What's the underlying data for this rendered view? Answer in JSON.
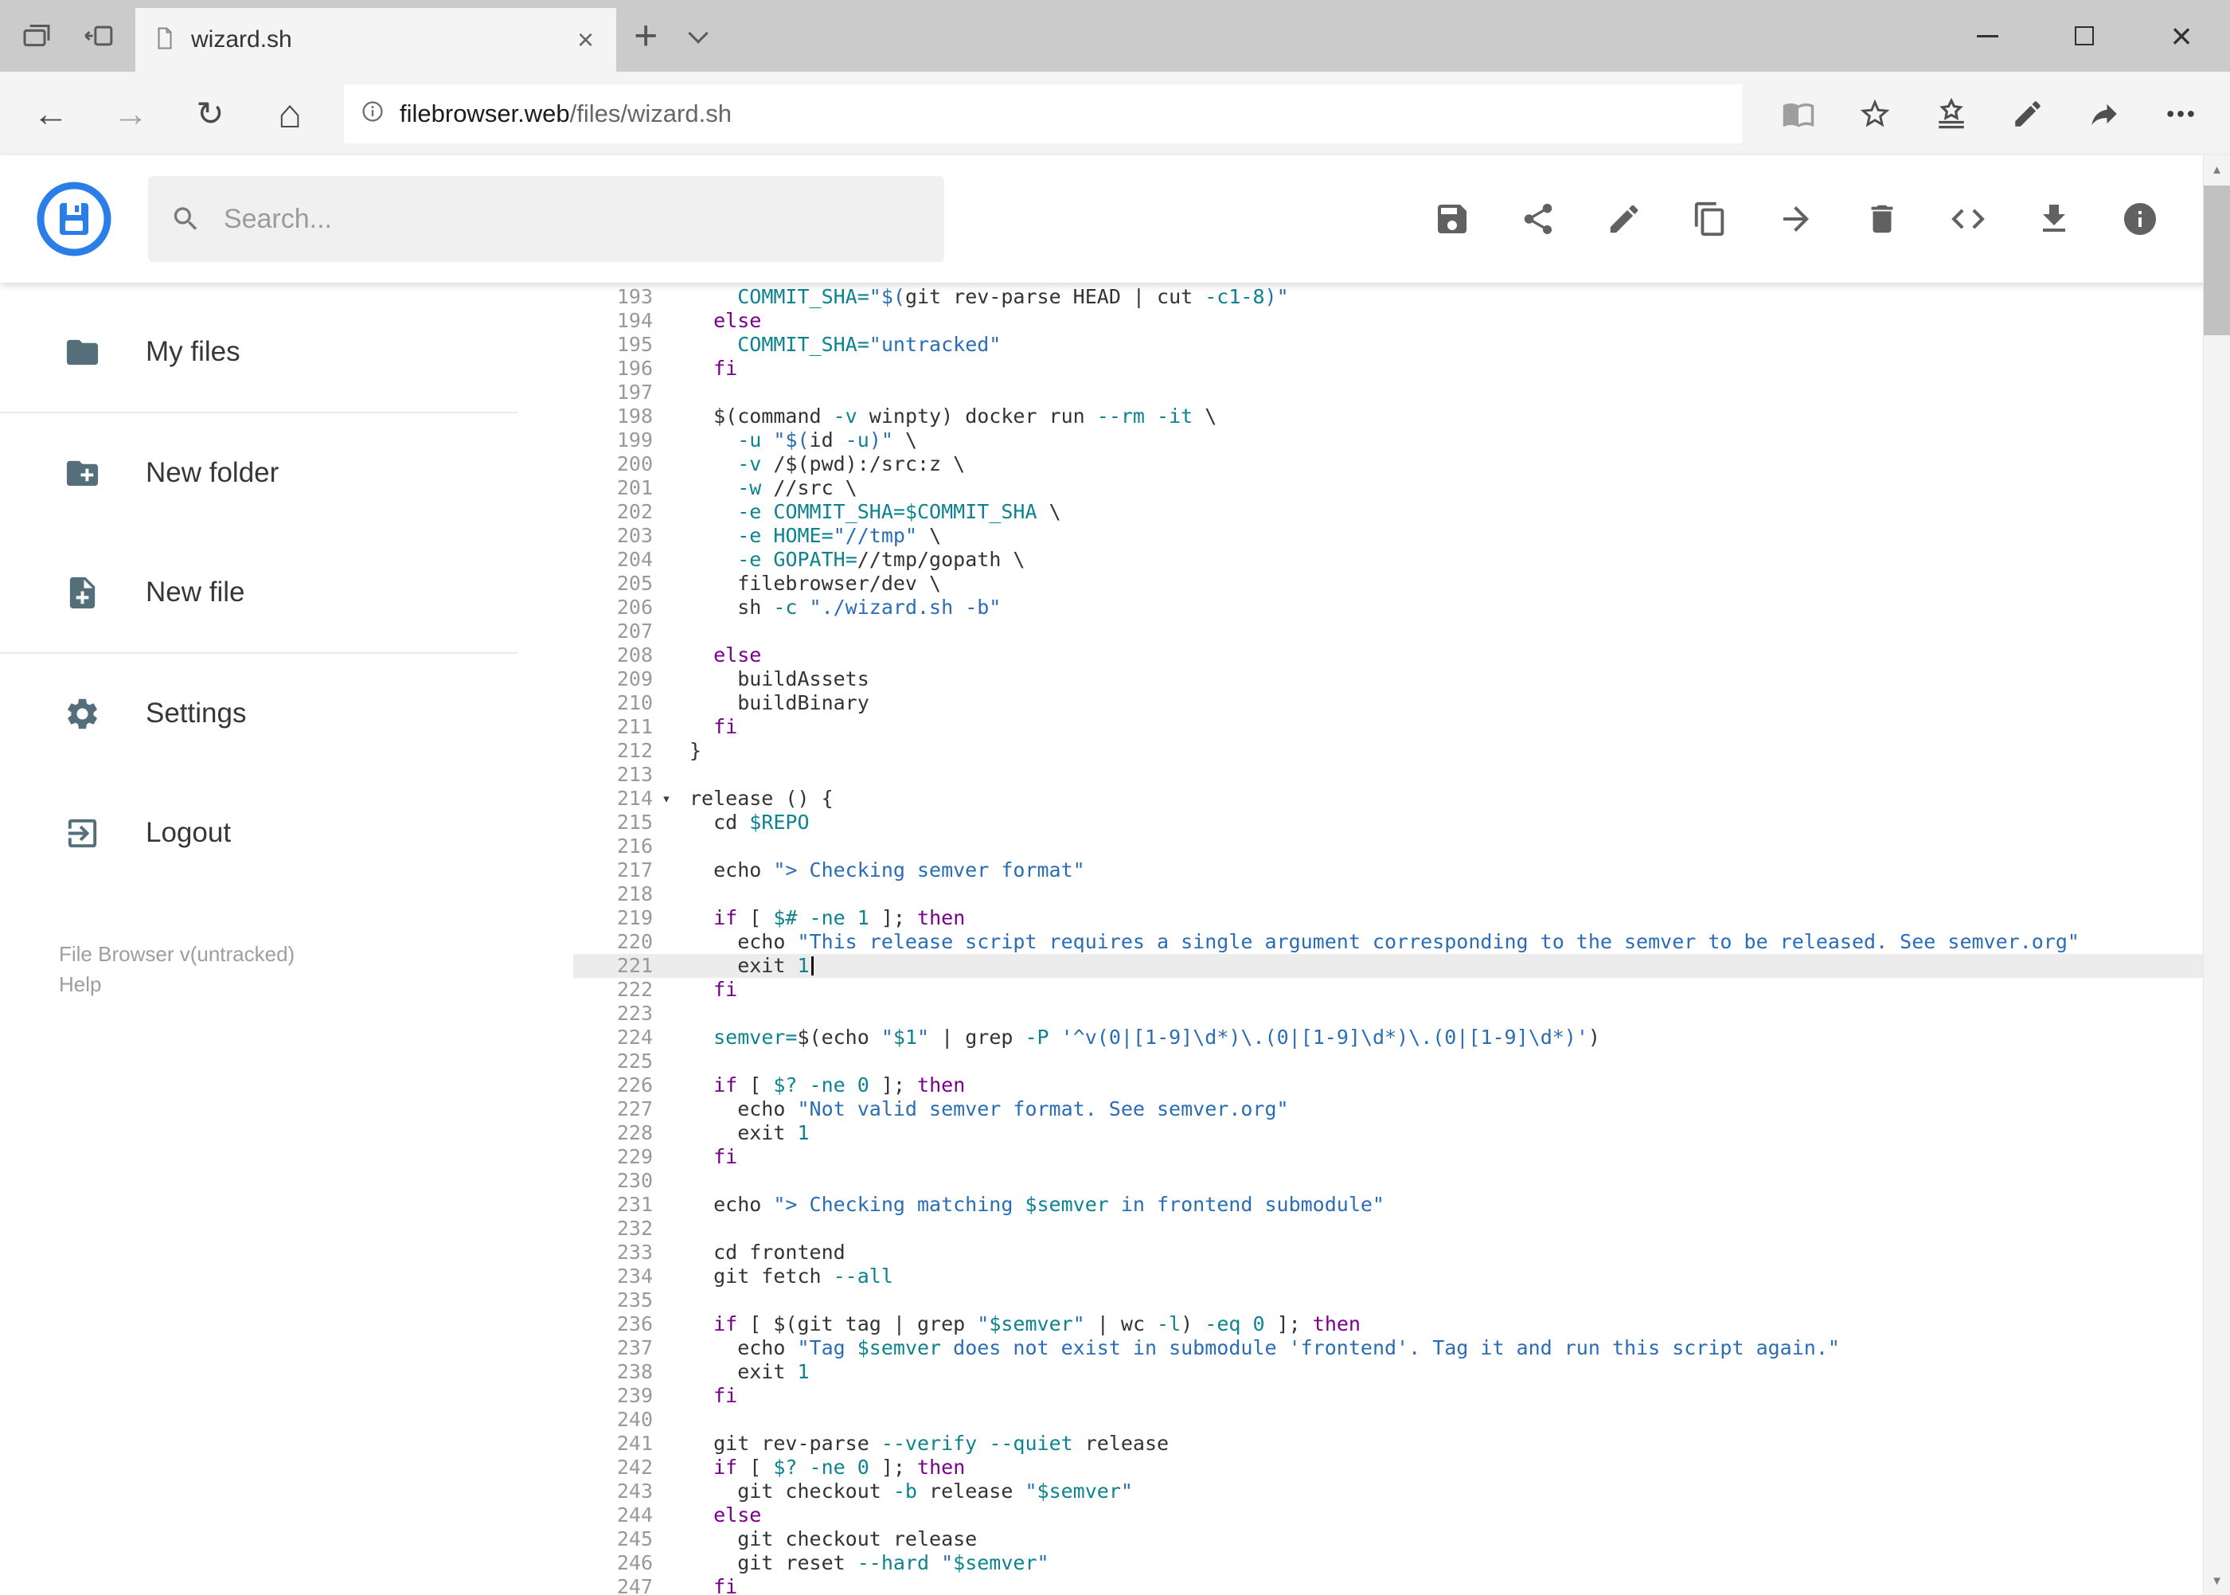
{
  "browser": {
    "tab": {
      "title": "wizard.sh"
    },
    "url": {
      "domain": "filebrowser.web",
      "path": "/files/wizard.sh"
    },
    "icons": {
      "back": "←",
      "forward": "→",
      "refresh": "↻",
      "home": "⌂",
      "close_tab": "×",
      "new_tab": "+",
      "window_close": "×",
      "scroll_up": "▲",
      "scroll_down": "▼"
    }
  },
  "app": {
    "accent_color": "#2b7de9",
    "search": {
      "placeholder": "Search..."
    },
    "actions": [
      {
        "name": "save",
        "icon": "floppy-icon"
      },
      {
        "name": "share",
        "icon": "share-nodes-icon"
      },
      {
        "name": "edit",
        "icon": "pencil-icon"
      },
      {
        "name": "copy",
        "icon": "copy-icon"
      },
      {
        "name": "move",
        "icon": "arrow-forward-icon"
      },
      {
        "name": "delete",
        "icon": "trash-icon"
      },
      {
        "name": "source",
        "icon": "code-icon"
      },
      {
        "name": "download",
        "icon": "download-icon"
      },
      {
        "name": "info",
        "icon": "info-icon"
      }
    ],
    "sidebar": {
      "items": [
        {
          "label": "My files",
          "icon": "folder-icon"
        },
        {
          "label": "New folder",
          "icon": "new-folder-icon"
        },
        {
          "label": "New file",
          "icon": "new-file-icon"
        },
        {
          "label": "Settings",
          "icon": "gear-icon"
        },
        {
          "label": "Logout",
          "icon": "logout-icon"
        }
      ],
      "footer": {
        "version": "File Browser v(untracked)",
        "help": "Help"
      }
    }
  },
  "editor": {
    "active_line": 221,
    "fold_line": 214,
    "fold_glyph": "▾",
    "colors": {
      "plain": "#333333",
      "keyword": "#770088",
      "string": "#2a6db5",
      "variable": "#0e8390"
    },
    "lines": [
      {
        "n": 193,
        "t": [
          [
            "p",
            "    "
          ],
          [
            "v",
            "COMMIT_SHA="
          ],
          [
            "s",
            "\"$("
          ],
          [
            "p",
            "git rev-parse HEAD | cut "
          ],
          [
            "v",
            "-c1-8"
          ],
          [
            "s",
            ")\""
          ]
        ]
      },
      {
        "n": 194,
        "t": [
          [
            "p",
            "  "
          ],
          [
            "k",
            "else"
          ]
        ]
      },
      {
        "n": 195,
        "t": [
          [
            "p",
            "    "
          ],
          [
            "v",
            "COMMIT_SHA="
          ],
          [
            "s",
            "\"untracked\""
          ]
        ]
      },
      {
        "n": 196,
        "t": [
          [
            "p",
            "  "
          ],
          [
            "k",
            "fi"
          ]
        ]
      },
      {
        "n": 197,
        "t": []
      },
      {
        "n": 198,
        "t": [
          [
            "p",
            "  $(command "
          ],
          [
            "v",
            "-v"
          ],
          [
            "p",
            " winpty) docker run "
          ],
          [
            "v",
            "--rm"
          ],
          [
            "p",
            " "
          ],
          [
            "v",
            "-it"
          ],
          [
            "p",
            " \\"
          ]
        ]
      },
      {
        "n": 199,
        "t": [
          [
            "p",
            "    "
          ],
          [
            "v",
            "-u"
          ],
          [
            "p",
            " "
          ],
          [
            "s",
            "\"$("
          ],
          [
            "p",
            "id "
          ],
          [
            "v",
            "-u"
          ],
          [
            "s",
            ")\""
          ],
          [
            "p",
            " \\"
          ]
        ]
      },
      {
        "n": 200,
        "t": [
          [
            "p",
            "    "
          ],
          [
            "v",
            "-v"
          ],
          [
            "p",
            " /$(pwd):/src:z \\"
          ]
        ]
      },
      {
        "n": 201,
        "t": [
          [
            "p",
            "    "
          ],
          [
            "v",
            "-w"
          ],
          [
            "p",
            " //src \\"
          ]
        ]
      },
      {
        "n": 202,
        "t": [
          [
            "p",
            "    "
          ],
          [
            "v",
            "-e"
          ],
          [
            "p",
            " "
          ],
          [
            "v",
            "COMMIT_SHA=$COMMIT_SHA"
          ],
          [
            "p",
            " \\"
          ]
        ]
      },
      {
        "n": 203,
        "t": [
          [
            "p",
            "    "
          ],
          [
            "v",
            "-e"
          ],
          [
            "p",
            " "
          ],
          [
            "v",
            "HOME="
          ],
          [
            "s",
            "\"//tmp\""
          ],
          [
            "p",
            " \\"
          ]
        ]
      },
      {
        "n": 204,
        "t": [
          [
            "p",
            "    "
          ],
          [
            "v",
            "-e"
          ],
          [
            "p",
            " "
          ],
          [
            "v",
            "GOPATH="
          ],
          [
            "p",
            "//tmp/gopath \\"
          ]
        ]
      },
      {
        "n": 205,
        "t": [
          [
            "p",
            "    filebrowser/dev \\"
          ]
        ]
      },
      {
        "n": 206,
        "t": [
          [
            "p",
            "    sh "
          ],
          [
            "v",
            "-c"
          ],
          [
            "p",
            " "
          ],
          [
            "s",
            "\"./wizard.sh -b\""
          ]
        ]
      },
      {
        "n": 207,
        "t": []
      },
      {
        "n": 208,
        "t": [
          [
            "p",
            "  "
          ],
          [
            "k",
            "else"
          ]
        ]
      },
      {
        "n": 209,
        "t": [
          [
            "p",
            "    buildAssets"
          ]
        ]
      },
      {
        "n": 210,
        "t": [
          [
            "p",
            "    buildBinary"
          ]
        ]
      },
      {
        "n": 211,
        "t": [
          [
            "p",
            "  "
          ],
          [
            "k",
            "fi"
          ]
        ]
      },
      {
        "n": 212,
        "t": [
          [
            "p",
            "}"
          ]
        ]
      },
      {
        "n": 213,
        "t": []
      },
      {
        "n": 214,
        "t": [
          [
            "p",
            "release () {"
          ]
        ]
      },
      {
        "n": 215,
        "t": [
          [
            "p",
            "  cd "
          ],
          [
            "v",
            "$REPO"
          ]
        ]
      },
      {
        "n": 216,
        "t": []
      },
      {
        "n": 217,
        "t": [
          [
            "p",
            "  echo "
          ],
          [
            "s",
            "\"> Checking semver format\""
          ]
        ]
      },
      {
        "n": 218,
        "t": []
      },
      {
        "n": 219,
        "t": [
          [
            "p",
            "  "
          ],
          [
            "k",
            "if"
          ],
          [
            "p",
            " [ "
          ],
          [
            "v",
            "$#"
          ],
          [
            "p",
            " "
          ],
          [
            "v",
            "-ne"
          ],
          [
            "p",
            " "
          ],
          [
            "v",
            "1"
          ],
          [
            "p",
            " ]; "
          ],
          [
            "k",
            "then"
          ]
        ]
      },
      {
        "n": 220,
        "t": [
          [
            "p",
            "    echo "
          ],
          [
            "s",
            "\"This release script requires a single argument corresponding to the semver to be released. See semver.org\""
          ]
        ]
      },
      {
        "n": 221,
        "t": [
          [
            "p",
            "    exit "
          ],
          [
            "v",
            "1"
          ]
        ]
      },
      {
        "n": 222,
        "t": [
          [
            "p",
            "  "
          ],
          [
            "k",
            "fi"
          ]
        ]
      },
      {
        "n": 223,
        "t": []
      },
      {
        "n": 224,
        "t": [
          [
            "p",
            "  "
          ],
          [
            "v",
            "semver="
          ],
          [
            "p",
            "$(echo "
          ],
          [
            "s",
            "\""
          ],
          [
            "v",
            "$1"
          ],
          [
            "s",
            "\""
          ],
          [
            "p",
            " | grep "
          ],
          [
            "v",
            "-P"
          ],
          [
            "p",
            " "
          ],
          [
            "s",
            "'^v(0|[1-9]\\d*)\\.(0|[1-9]\\d*)\\.(0|[1-9]\\d*)'"
          ],
          [
            "p",
            ")"
          ]
        ]
      },
      {
        "n": 225,
        "t": []
      },
      {
        "n": 226,
        "t": [
          [
            "p",
            "  "
          ],
          [
            "k",
            "if"
          ],
          [
            "p",
            " [ "
          ],
          [
            "v",
            "$?"
          ],
          [
            "p",
            " "
          ],
          [
            "v",
            "-ne"
          ],
          [
            "p",
            " "
          ],
          [
            "v",
            "0"
          ],
          [
            "p",
            " ]; "
          ],
          [
            "k",
            "then"
          ]
        ]
      },
      {
        "n": 227,
        "t": [
          [
            "p",
            "    echo "
          ],
          [
            "s",
            "\"Not valid semver format. See semver.org\""
          ]
        ]
      },
      {
        "n": 228,
        "t": [
          [
            "p",
            "    exit "
          ],
          [
            "v",
            "1"
          ]
        ]
      },
      {
        "n": 229,
        "t": [
          [
            "p",
            "  "
          ],
          [
            "k",
            "fi"
          ]
        ]
      },
      {
        "n": 230,
        "t": []
      },
      {
        "n": 231,
        "t": [
          [
            "p",
            "  echo "
          ],
          [
            "s",
            "\"> Checking matching "
          ],
          [
            "v",
            "$semver"
          ],
          [
            "s",
            " in frontend submodule\""
          ]
        ]
      },
      {
        "n": 232,
        "t": []
      },
      {
        "n": 233,
        "t": [
          [
            "p",
            "  cd frontend"
          ]
        ]
      },
      {
        "n": 234,
        "t": [
          [
            "p",
            "  git fetch "
          ],
          [
            "v",
            "--all"
          ]
        ]
      },
      {
        "n": 235,
        "t": []
      },
      {
        "n": 236,
        "t": [
          [
            "p",
            "  "
          ],
          [
            "k",
            "if"
          ],
          [
            "p",
            " [ $(git tag | grep "
          ],
          [
            "s",
            "\""
          ],
          [
            "v",
            "$semver"
          ],
          [
            "s",
            "\""
          ],
          [
            "p",
            " | wc "
          ],
          [
            "v",
            "-l"
          ],
          [
            "p",
            ") "
          ],
          [
            "v",
            "-eq"
          ],
          [
            "p",
            " "
          ],
          [
            "v",
            "0"
          ],
          [
            "p",
            " ]; "
          ],
          [
            "k",
            "then"
          ]
        ]
      },
      {
        "n": 237,
        "t": [
          [
            "p",
            "    echo "
          ],
          [
            "s",
            "\"Tag "
          ],
          [
            "v",
            "$semver"
          ],
          [
            "s",
            " does not exist in submodule 'frontend'. Tag it and run this script again.\""
          ]
        ]
      },
      {
        "n": 238,
        "t": [
          [
            "p",
            "    exit "
          ],
          [
            "v",
            "1"
          ]
        ]
      },
      {
        "n": 239,
        "t": [
          [
            "p",
            "  "
          ],
          [
            "k",
            "fi"
          ]
        ]
      },
      {
        "n": 240,
        "t": []
      },
      {
        "n": 241,
        "t": [
          [
            "p",
            "  git rev-parse "
          ],
          [
            "v",
            "--verify"
          ],
          [
            "p",
            " "
          ],
          [
            "v",
            "--quiet"
          ],
          [
            "p",
            " release"
          ]
        ]
      },
      {
        "n": 242,
        "t": [
          [
            "p",
            "  "
          ],
          [
            "k",
            "if"
          ],
          [
            "p",
            " [ "
          ],
          [
            "v",
            "$?"
          ],
          [
            "p",
            " "
          ],
          [
            "v",
            "-ne"
          ],
          [
            "p",
            " "
          ],
          [
            "v",
            "0"
          ],
          [
            "p",
            " ]; "
          ],
          [
            "k",
            "then"
          ]
        ]
      },
      {
        "n": 243,
        "t": [
          [
            "p",
            "    git checkout "
          ],
          [
            "v",
            "-b"
          ],
          [
            "p",
            " release "
          ],
          [
            "s",
            "\""
          ],
          [
            "v",
            "$semver"
          ],
          [
            "s",
            "\""
          ]
        ]
      },
      {
        "n": 244,
        "t": [
          [
            "p",
            "  "
          ],
          [
            "k",
            "else"
          ]
        ]
      },
      {
        "n": 245,
        "t": [
          [
            "p",
            "    git checkout release"
          ]
        ]
      },
      {
        "n": 246,
        "t": [
          [
            "p",
            "    git reset "
          ],
          [
            "v",
            "--hard"
          ],
          [
            "p",
            " "
          ],
          [
            "s",
            "\""
          ],
          [
            "v",
            "$semver"
          ],
          [
            "s",
            "\""
          ]
        ]
      },
      {
        "n": 247,
        "t": [
          [
            "p",
            "  "
          ],
          [
            "k",
            "fi"
          ]
        ]
      }
    ]
  }
}
